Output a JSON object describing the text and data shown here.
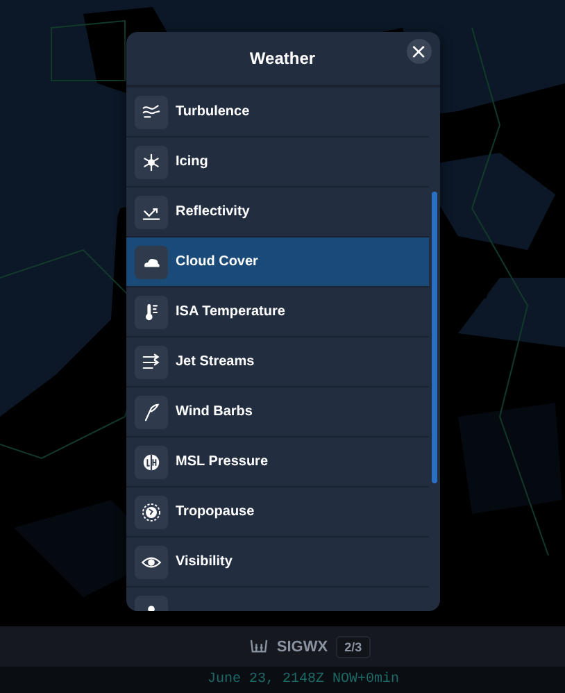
{
  "dialog": {
    "title": "Weather",
    "close": "×"
  },
  "items": [
    {
      "label": "Turbulence",
      "selected": false
    },
    {
      "label": "Icing",
      "selected": false
    },
    {
      "label": "Reflectivity",
      "selected": false
    },
    {
      "label": "Cloud Cover",
      "selected": true
    },
    {
      "label": "ISA Temperature",
      "selected": false
    },
    {
      "label": "Jet Streams",
      "selected": false
    },
    {
      "label": "Wind Barbs",
      "selected": false
    },
    {
      "label": "MSL Pressure",
      "selected": false
    },
    {
      "label": "Tropopause",
      "selected": false
    },
    {
      "label": "Visibility",
      "selected": false
    }
  ],
  "layer_bar": {
    "name": "SIGWX",
    "page": "2/3"
  },
  "time_bar": {
    "text": "June 23, 2148Z NOW+0min"
  }
}
